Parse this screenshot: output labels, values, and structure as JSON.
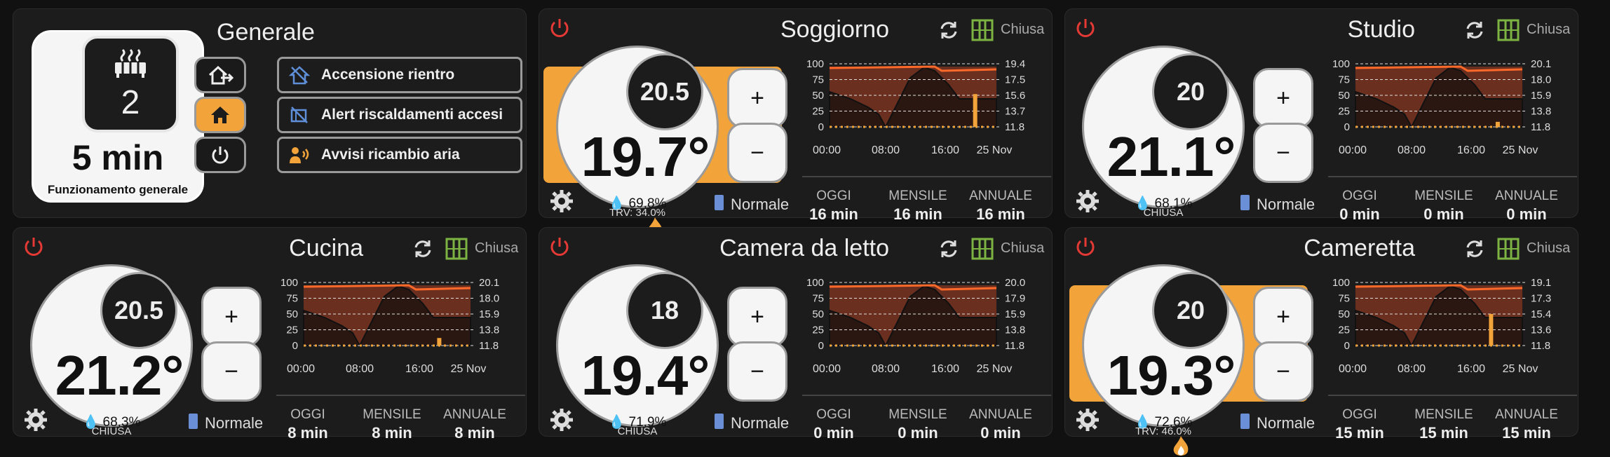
{
  "general": {
    "title": "Generale",
    "active_count": "2",
    "duration": "5 min",
    "subtitle": "Funzionamento generale",
    "mode_buttons": [
      "away-home-icon",
      "home-icon",
      "power-icon"
    ],
    "alerts": [
      {
        "label": "Accensione rientro",
        "icon": "home-off-icon"
      },
      {
        "label": "Alert riscaldamenti accesi",
        "icon": "radiator-off-icon"
      },
      {
        "label": "Avvisi ricambio aria",
        "icon": "air-purifier-icon"
      }
    ]
  },
  "colors": {
    "accent": "#f2a33a",
    "power": "#e53935",
    "window": "#7cb342",
    "chart_fill": "#6b2f1f",
    "battery": "#6b8fd6"
  },
  "common": {
    "window_state": "Chiusa",
    "mode": "Normale",
    "stat_labels": [
      "OGGI",
      "MENSILE",
      "ANNUALE"
    ],
    "axis_left": [
      "100",
      "75",
      "50",
      "25",
      "0"
    ],
    "axis_x": [
      "00:00",
      "08:00",
      "16:00",
      "25 Nov"
    ]
  },
  "rooms": [
    {
      "name": "Soggiorno",
      "setpoint": "20.5",
      "temp": "19.7°",
      "humidity": "69,8%",
      "heating": true,
      "under": "TRV: 34.0%",
      "axis_right": [
        "19.4",
        "17.5",
        "15.6",
        "13.7",
        "11.8"
      ],
      "stats": [
        "16 min",
        "16 min",
        "16 min"
      ],
      "chart_data": {
        "type": "line",
        "bars": [
          {
            "x": 0.86,
            "h": 0.52
          }
        ]
      }
    },
    {
      "name": "Studio",
      "setpoint": "20",
      "temp": "21.1°",
      "humidity": "68,1%",
      "heating": false,
      "under": "CHIUSA",
      "axis_right": [
        "20.1",
        "18.0",
        "15.9",
        "13.8",
        "11.8"
      ],
      "stats": [
        "0 min",
        "0 min",
        "0 min"
      ],
      "chart_data": {
        "type": "line",
        "bars": [
          {
            "x": 0.84,
            "h": 0.08
          }
        ]
      }
    },
    {
      "name": "Cucina",
      "setpoint": "20.5",
      "temp": "21.2°",
      "humidity": "68,3%",
      "heating": false,
      "under": "CHIUSA",
      "axis_right": [
        "20.1",
        "18.0",
        "15.9",
        "13.8",
        "11.8"
      ],
      "stats": [
        "8 min",
        "8 min",
        "8 min"
      ],
      "chart_data": {
        "type": "line",
        "bars": [
          {
            "x": 0.8,
            "h": 0.12
          }
        ]
      }
    },
    {
      "name": "Camera da letto",
      "setpoint": "18",
      "temp": "19.4°",
      "humidity": "71,9%",
      "heating": false,
      "under": "CHIUSA",
      "axis_right": [
        "20.0",
        "17.9",
        "15.9",
        "13.8",
        "11.8"
      ],
      "stats": [
        "0 min",
        "0 min",
        "0 min"
      ],
      "chart_data": {
        "type": "line",
        "bars": []
      }
    },
    {
      "name": "Cameretta",
      "setpoint": "20",
      "temp": "19.3°",
      "humidity": "72,6%",
      "heating": true,
      "under": "TRV: 46.0%",
      "axis_right": [
        "19.1",
        "17.3",
        "15.4",
        "13.6",
        "11.8"
      ],
      "stats": [
        "15 min",
        "15 min",
        "15 min"
      ],
      "chart_data": {
        "type": "line",
        "bars": [
          {
            "x": 0.8,
            "h": 0.5
          }
        ]
      }
    }
  ]
}
